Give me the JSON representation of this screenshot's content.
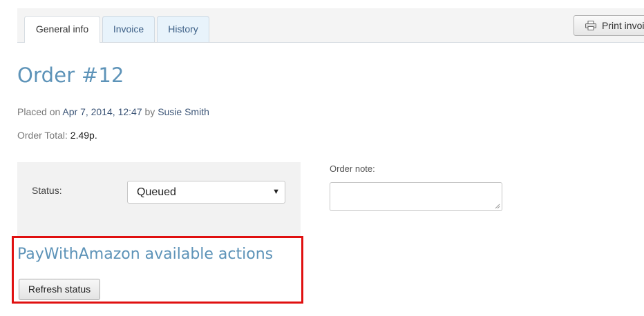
{
  "tabs": [
    {
      "label": "General info",
      "active": true
    },
    {
      "label": "Invoice",
      "active": false
    },
    {
      "label": "History",
      "active": false
    }
  ],
  "toolbar": {
    "print_label": "Print invoi",
    "print_icon": "printer-icon"
  },
  "order": {
    "title": "Order #12",
    "placed_prefix": "Placed on",
    "placed_date": "Apr 7, 2014, 12:47",
    "by_text": "by",
    "customer": "Susie Smith",
    "total_label": "Order Total:",
    "total_value": "2.49p."
  },
  "status": {
    "label": "Status:",
    "selected": "Queued"
  },
  "note": {
    "label": "Order note:",
    "value": ""
  },
  "amazon": {
    "title": "PayWithAmazon available actions",
    "refresh_label": "Refresh status"
  },
  "colors": {
    "heading": "#5d93b8",
    "highlight": "#e01010",
    "tab_inactive_bg": "#e8f3fb"
  }
}
